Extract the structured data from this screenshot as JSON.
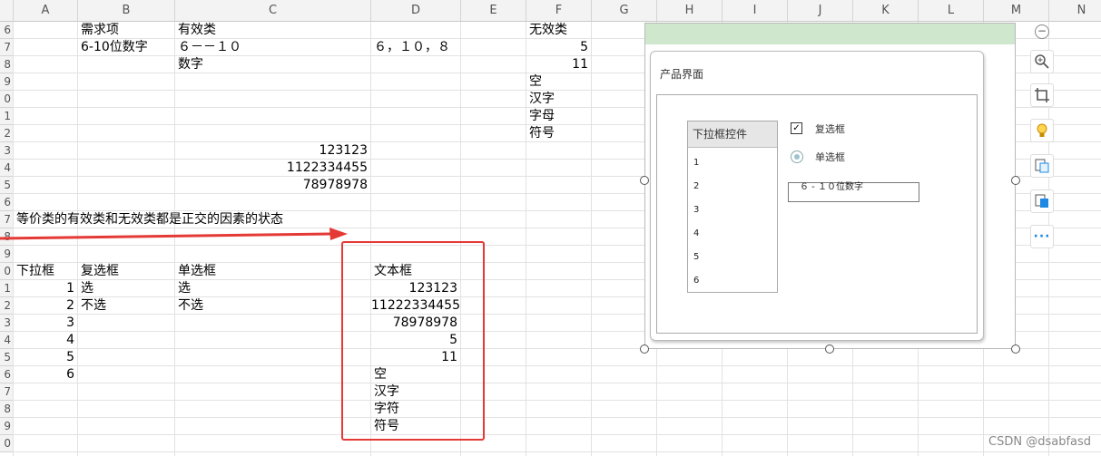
{
  "columns": [
    {
      "label": "",
      "w": 15
    },
    {
      "label": "A",
      "w": 71
    },
    {
      "label": "B",
      "w": 107
    },
    {
      "label": "C",
      "w": 216
    },
    {
      "label": "D",
      "w": 99
    },
    {
      "label": "E",
      "w": 72
    },
    {
      "label": "F",
      "w": 72
    },
    {
      "label": "G",
      "w": 72
    },
    {
      "label": "H",
      "w": 72
    },
    {
      "label": "I",
      "w": 72
    },
    {
      "label": "J",
      "w": 72
    },
    {
      "label": "K",
      "w": 72
    },
    {
      "label": "L",
      "w": 72
    },
    {
      "label": "M",
      "w": 72
    },
    {
      "label": "N",
      "w": 72
    }
  ],
  "rows": [
    "5",
    "7",
    "8",
    "9",
    "0",
    "1",
    "2",
    "3",
    "4",
    "5",
    "7",
    "8",
    "9",
    "0",
    "1",
    "2",
    "3",
    "4",
    "5",
    "6",
    "7",
    "8",
    "9"
  ],
  "cells": {
    "b6": "需求项",
    "c6": "有效类",
    "f6": "无效类",
    "b7": "6-10位数字",
    "c7": "６－－１０",
    "d7": "６，１０，８",
    "f7": "5",
    "c8": "数字",
    "f8": "11",
    "f9": "空",
    "f10": "汉字",
    "f11": "字母",
    "f12": "符号",
    "c13": "123123",
    "c14": "1122334455",
    "c15": "78978978",
    "a17": "等价类的有效类和无效类都是正交的因素的状态",
    "a20": "下拉框",
    "b20": "复选框",
    "c20": "单选框",
    "d20": "文本框",
    "a21": "1",
    "b21": "选",
    "c21": "选",
    "d21": "123123",
    "a22": "2",
    "b22": "不选",
    "c22": "不选",
    "d22": "11222334455",
    "a23": "3",
    "d23": "78978978",
    "a24": "4",
    "d24": "5",
    "a25": "5",
    "d25": "11",
    "a26": "6",
    "d26": "空",
    "d27": "汉字",
    "d28": "字符",
    "d29": "符号"
  },
  "embedded_image": {
    "title": "产品界面",
    "dropdown_header": "下拉框控件",
    "dropdown_items": [
      "1",
      "2",
      "3",
      "4",
      "5",
      "6"
    ],
    "checkbox_label": "复选框",
    "radio_label": "单选框",
    "textbox_value": "６ - １０位数字"
  },
  "toolbar": {
    "icons": [
      "minus-icon",
      "zoom-icon",
      "crop-icon",
      "bulb-icon",
      "image-convert-icon",
      "image-edit-icon",
      "more-icon"
    ]
  },
  "watermark": "CSDN @dsabfasd"
}
